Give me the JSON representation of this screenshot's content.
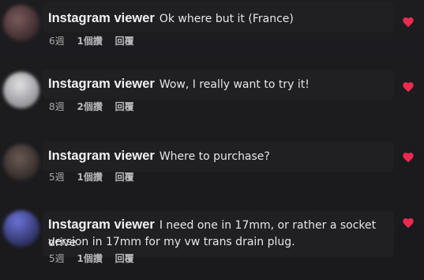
{
  "comments": [
    {
      "author": "Instagram viewer",
      "text": "Ok where but it (France)",
      "age": "6週",
      "likes": "1個讚",
      "reply": "回覆",
      "avatar_color": "#6a4a4a"
    },
    {
      "author": "Instagram viewer",
      "text": "Wow, I really want to try it!",
      "age": "8週",
      "likes": "2個讚",
      "reply": "回覆",
      "avatar_color": "#c9c9cc"
    },
    {
      "author": "Instagram viewer",
      "text": "Where to purchase?",
      "age": "5週",
      "likes": "1個讚",
      "reply": "回覆",
      "avatar_color": "#5a4840"
    },
    {
      "author": "Instagram viewer",
      "text_line1": "I need one in 17mm, or rather a socket drive",
      "text_line2": "version in 17mm for my vw trans drain plug.",
      "age": "5週",
      "likes": "1個讚",
      "reply": "回覆",
      "avatar_color": "#4a4f9e"
    }
  ],
  "colors": {
    "background": "#1c1c1e",
    "heart": "#ee2a4f",
    "text": "#e6e6e8",
    "meta": "#a9a9ad"
  },
  "icons": {
    "like": "heart-icon"
  }
}
